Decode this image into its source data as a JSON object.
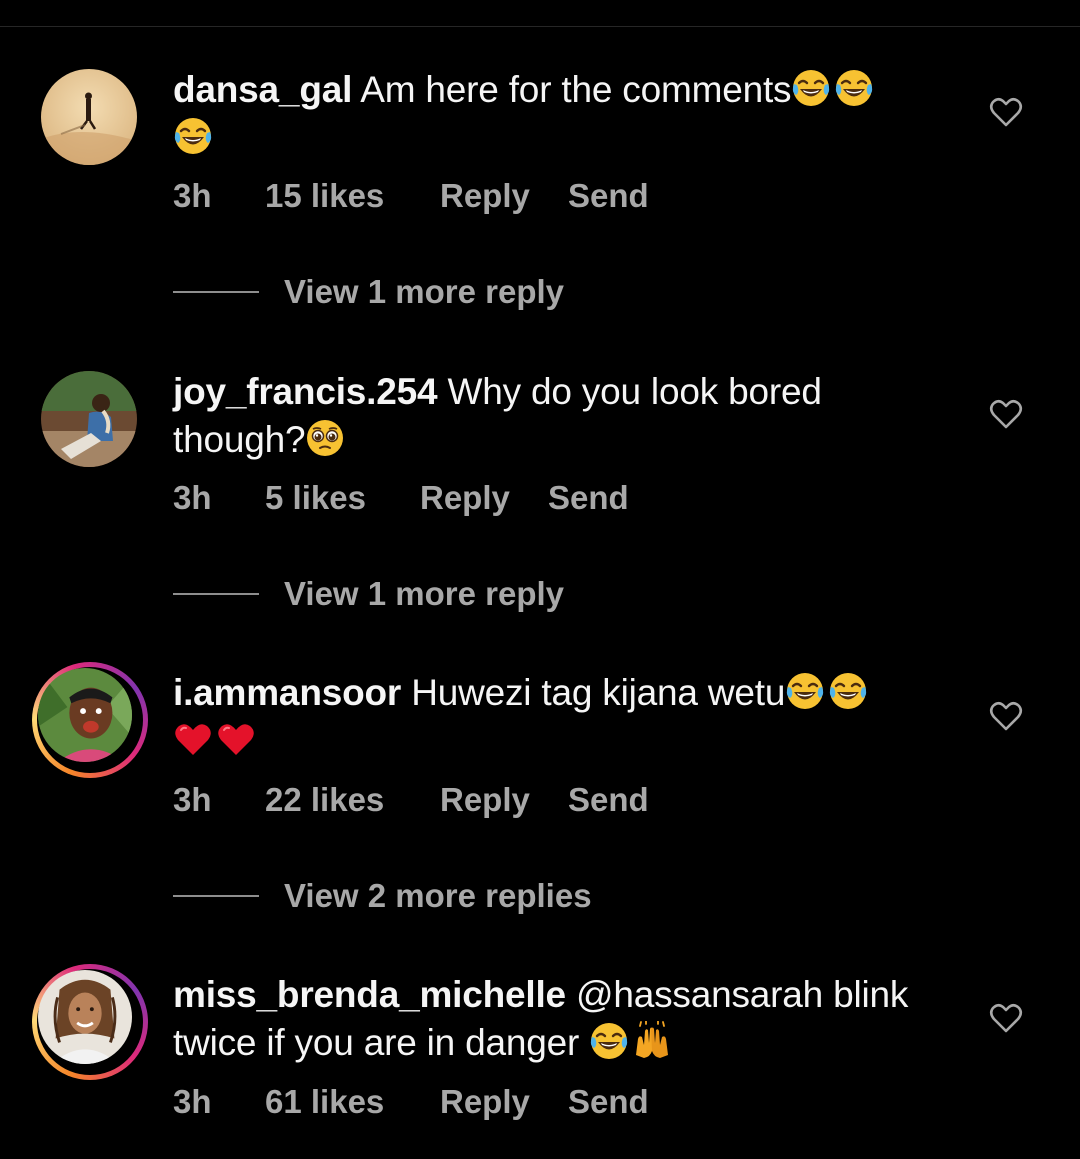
{
  "comments": [
    {
      "username": "dansa_gal",
      "text_line1": "Am here for the comments",
      "text_line2": "",
      "mention": "",
      "time": "3h",
      "likes": "15 likes",
      "reply_label": "Reply",
      "send_label": "Send",
      "view_replies": "View 1 more reply",
      "emojis": [
        "tears-of-joy",
        "tears-of-joy",
        "tears-of-joy"
      ]
    },
    {
      "username": "joy_francis.254",
      "text_line1": "Why do you look bored",
      "text_line2": "though?",
      "mention": "",
      "time": "3h",
      "likes": "5 likes",
      "reply_label": "Reply",
      "send_label": "Send",
      "view_replies": "View 1 more reply",
      "emojis": [
        "pleading-face"
      ]
    },
    {
      "username": "i.ammansoor",
      "text_line1": "Huwezi tag kijana wetu",
      "text_line2": "",
      "mention": "",
      "time": "3h",
      "likes": "22 likes",
      "reply_label": "Reply",
      "send_label": "Send",
      "view_replies": "View 2 more replies",
      "emojis": [
        "tears-of-joy",
        "tears-of-joy",
        "red-heart",
        "red-heart"
      ]
    },
    {
      "username": "miss_brenda_michelle",
      "text_line1": "blink",
      "text_line2": "twice if you are in danger",
      "mention": "@hassansarah",
      "time": "3h",
      "likes": "61 likes",
      "reply_label": "Reply",
      "send_label": "Send",
      "view_replies": "",
      "emojis": [
        "tears-of-joy",
        "raising-hands"
      ]
    }
  ],
  "colors": {
    "background": "#000000",
    "primary_text": "#f5f5f5",
    "secondary_text": "#a8a8a8",
    "story_ring": [
      "#f58529",
      "#dd2a7b",
      "#8134af"
    ]
  }
}
